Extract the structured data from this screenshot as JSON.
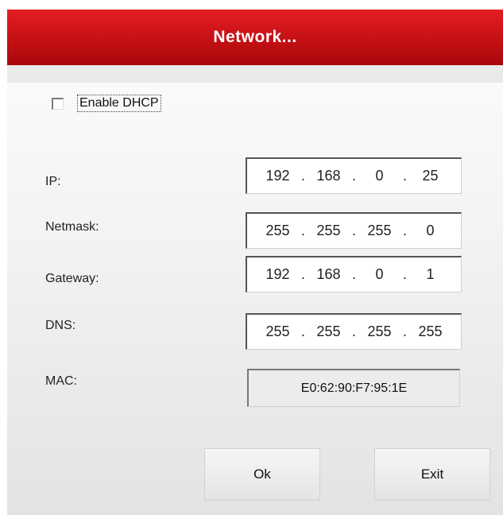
{
  "dialog": {
    "title": "Network..."
  },
  "dhcp": {
    "label": "Enable DHCP",
    "checked": false
  },
  "fields": {
    "ip": {
      "label": "IP:",
      "octets": [
        "192",
        "168",
        "0",
        "25"
      ]
    },
    "netmask": {
      "label": "Netmask:",
      "octets": [
        "255",
        "255",
        "255",
        "0"
      ]
    },
    "gateway": {
      "label": "Gateway:",
      "octets": [
        "192",
        "168",
        "0",
        "1"
      ]
    },
    "dns": {
      "label": "DNS:",
      "octets": [
        "255",
        "255",
        "255",
        "255"
      ]
    }
  },
  "mac": {
    "label": "MAC:",
    "value": "E0:62:90:F7:95:1E"
  },
  "buttons": {
    "ok": "Ok",
    "exit": "Exit"
  },
  "colors": {
    "titlebar": "#c10f13",
    "title_text": "#ffffff"
  },
  "separator": "."
}
